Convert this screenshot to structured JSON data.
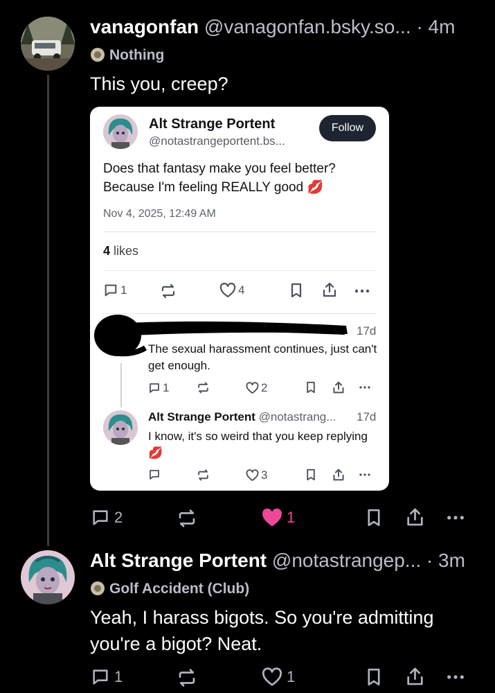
{
  "post1": {
    "display_name": "vanagonfan",
    "handle": "@vanagonfan.bsky.so...",
    "time": "· 4m",
    "tag": "Nothing",
    "text": "This you, creep?",
    "actions": {
      "replies": "2",
      "likes": "1",
      "liked": true
    }
  },
  "quote": {
    "display_name": "Alt Strange Portent",
    "handle": "@notastrangeportent.bs...",
    "follow_label": "Follow",
    "text": "Does that fantasy make you feel better? Because I'm feeling REALLY good",
    "emoji": "💋",
    "date": "Nov 4, 2025, 12:49 AM",
    "likes_count": "4",
    "likes_label": " likes",
    "actions": {
      "replies": "1",
      "likes": "4"
    },
    "reply1": {
      "time": "17d",
      "text": "The sexual harassment continues, just can't get enough.",
      "actions": {
        "replies": "1",
        "likes": "2"
      }
    },
    "reply2": {
      "display_name": "Alt Strange Portent",
      "handle": "@notastrang...",
      "time": "17d",
      "text": "I know, it's so weird that you keep replying",
      "emoji": "💋",
      "actions": {
        "likes": "3"
      }
    }
  },
  "post2": {
    "display_name": "Alt Strange Portent",
    "handle": "@notastrangep...",
    "time": "· 3m",
    "tag": "Golf Accident (Club)",
    "text": "Yeah, I harass bigots. So you're admitting you're a bigot? Neat.",
    "actions": {
      "replies": "1",
      "likes": "1"
    }
  },
  "colors": {
    "background": "#000000",
    "like_active": "#ec4899",
    "muted": "#aeb3be"
  }
}
